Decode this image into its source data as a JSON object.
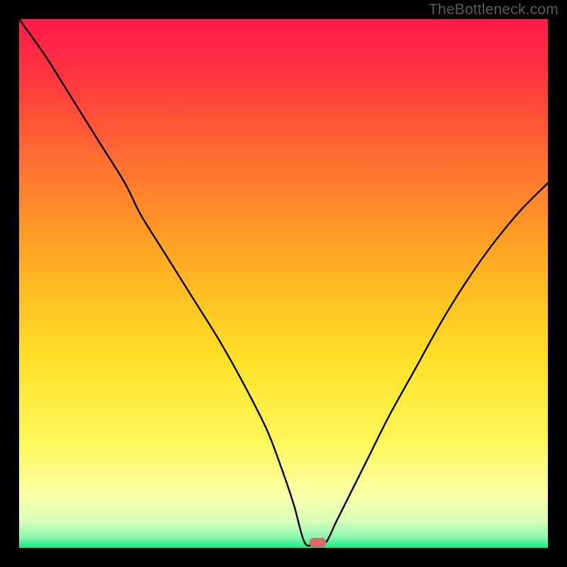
{
  "watermark": "TheBottleneck.com",
  "colors": {
    "page_bg": "#000000",
    "watermark": "#5b5b5b",
    "curve": "#000000",
    "marker": "#d46a6a",
    "gradient_stops": [
      {
        "offset": 0,
        "color": "#ff1a4b"
      },
      {
        "offset": 12,
        "color": "#ff3a3f"
      },
      {
        "offset": 30,
        "color": "#ff7a2f"
      },
      {
        "offset": 48,
        "color": "#ffb321"
      },
      {
        "offset": 64,
        "color": "#ffe028"
      },
      {
        "offset": 80,
        "color": "#fff85a"
      },
      {
        "offset": 90,
        "color": "#faffa8"
      },
      {
        "offset": 95,
        "color": "#d8ffb8"
      },
      {
        "offset": 98,
        "color": "#8cf7b0"
      },
      {
        "offset": 100,
        "color": "#17e884"
      }
    ]
  },
  "chart_data": {
    "type": "line",
    "title": "",
    "xlabel": "",
    "ylabel": "",
    "xlim": [
      0,
      100
    ],
    "ylim": [
      0,
      100
    ],
    "optimal_x": 56,
    "flat_range_x": [
      54,
      58
    ],
    "marker": {
      "x_center": 56.5,
      "width_pct": 3.2,
      "height_pct": 1.8,
      "y_center": 1.0
    },
    "series": [
      {
        "name": "bottleneck-curve",
        "x": [
          0,
          5,
          10,
          15,
          20,
          23,
          28,
          33,
          38,
          43,
          47,
          50,
          52,
          54,
          56,
          58,
          60,
          63,
          66,
          70,
          75,
          80,
          85,
          90,
          95,
          100
        ],
        "y": [
          100,
          93,
          85,
          77,
          69,
          63,
          55,
          47,
          39,
          30,
          22,
          14,
          8,
          1,
          0.7,
          1,
          5,
          11,
          17,
          25,
          34,
          43,
          51,
          58,
          64,
          69
        ]
      }
    ]
  }
}
